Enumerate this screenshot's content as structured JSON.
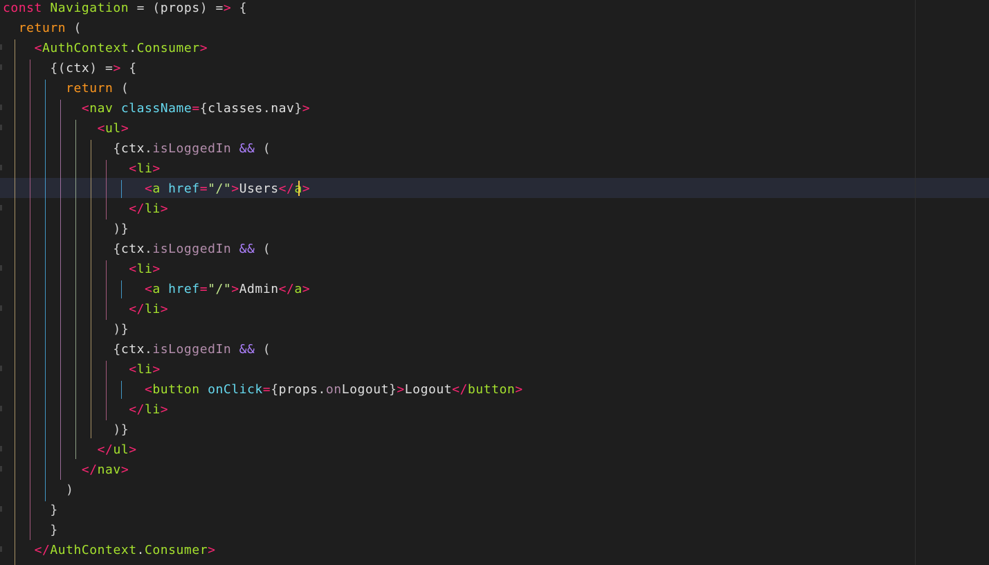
{
  "editor": {
    "lines": [
      "const Navigation = (props) => {",
      "  return (",
      "    <AuthContext.Consumer>",
      "      {(ctx) => {",
      "        return (",
      "          <nav className={classes.nav}>",
      "            <ul>",
      "              {ctx.isLoggedIn && (",
      "                <li>",
      "                  <a href=\"/\">Users</a>",
      "                </li>",
      "              )}",
      "              {ctx.isLoggedIn && (",
      "                <li>",
      "                  <a href=\"/\">Admin</a>",
      "                </li>",
      "              )}",
      "              {ctx.isLoggedIn && (",
      "                <li>",
      "                  <button onClick={props.onLogout}>Logout</button>",
      "                </li>",
      "              )}",
      "            </ul>",
      "          </nav>",
      "        )",
      "      }",
      "      }",
      "    </AuthContext.Consumer>"
    ],
    "active_line_index": 9,
    "colors": {
      "background": "#1e1e1e",
      "current_line": "#272a36",
      "cursor": "#f5c842",
      "match_highlight": "#36544a"
    }
  }
}
